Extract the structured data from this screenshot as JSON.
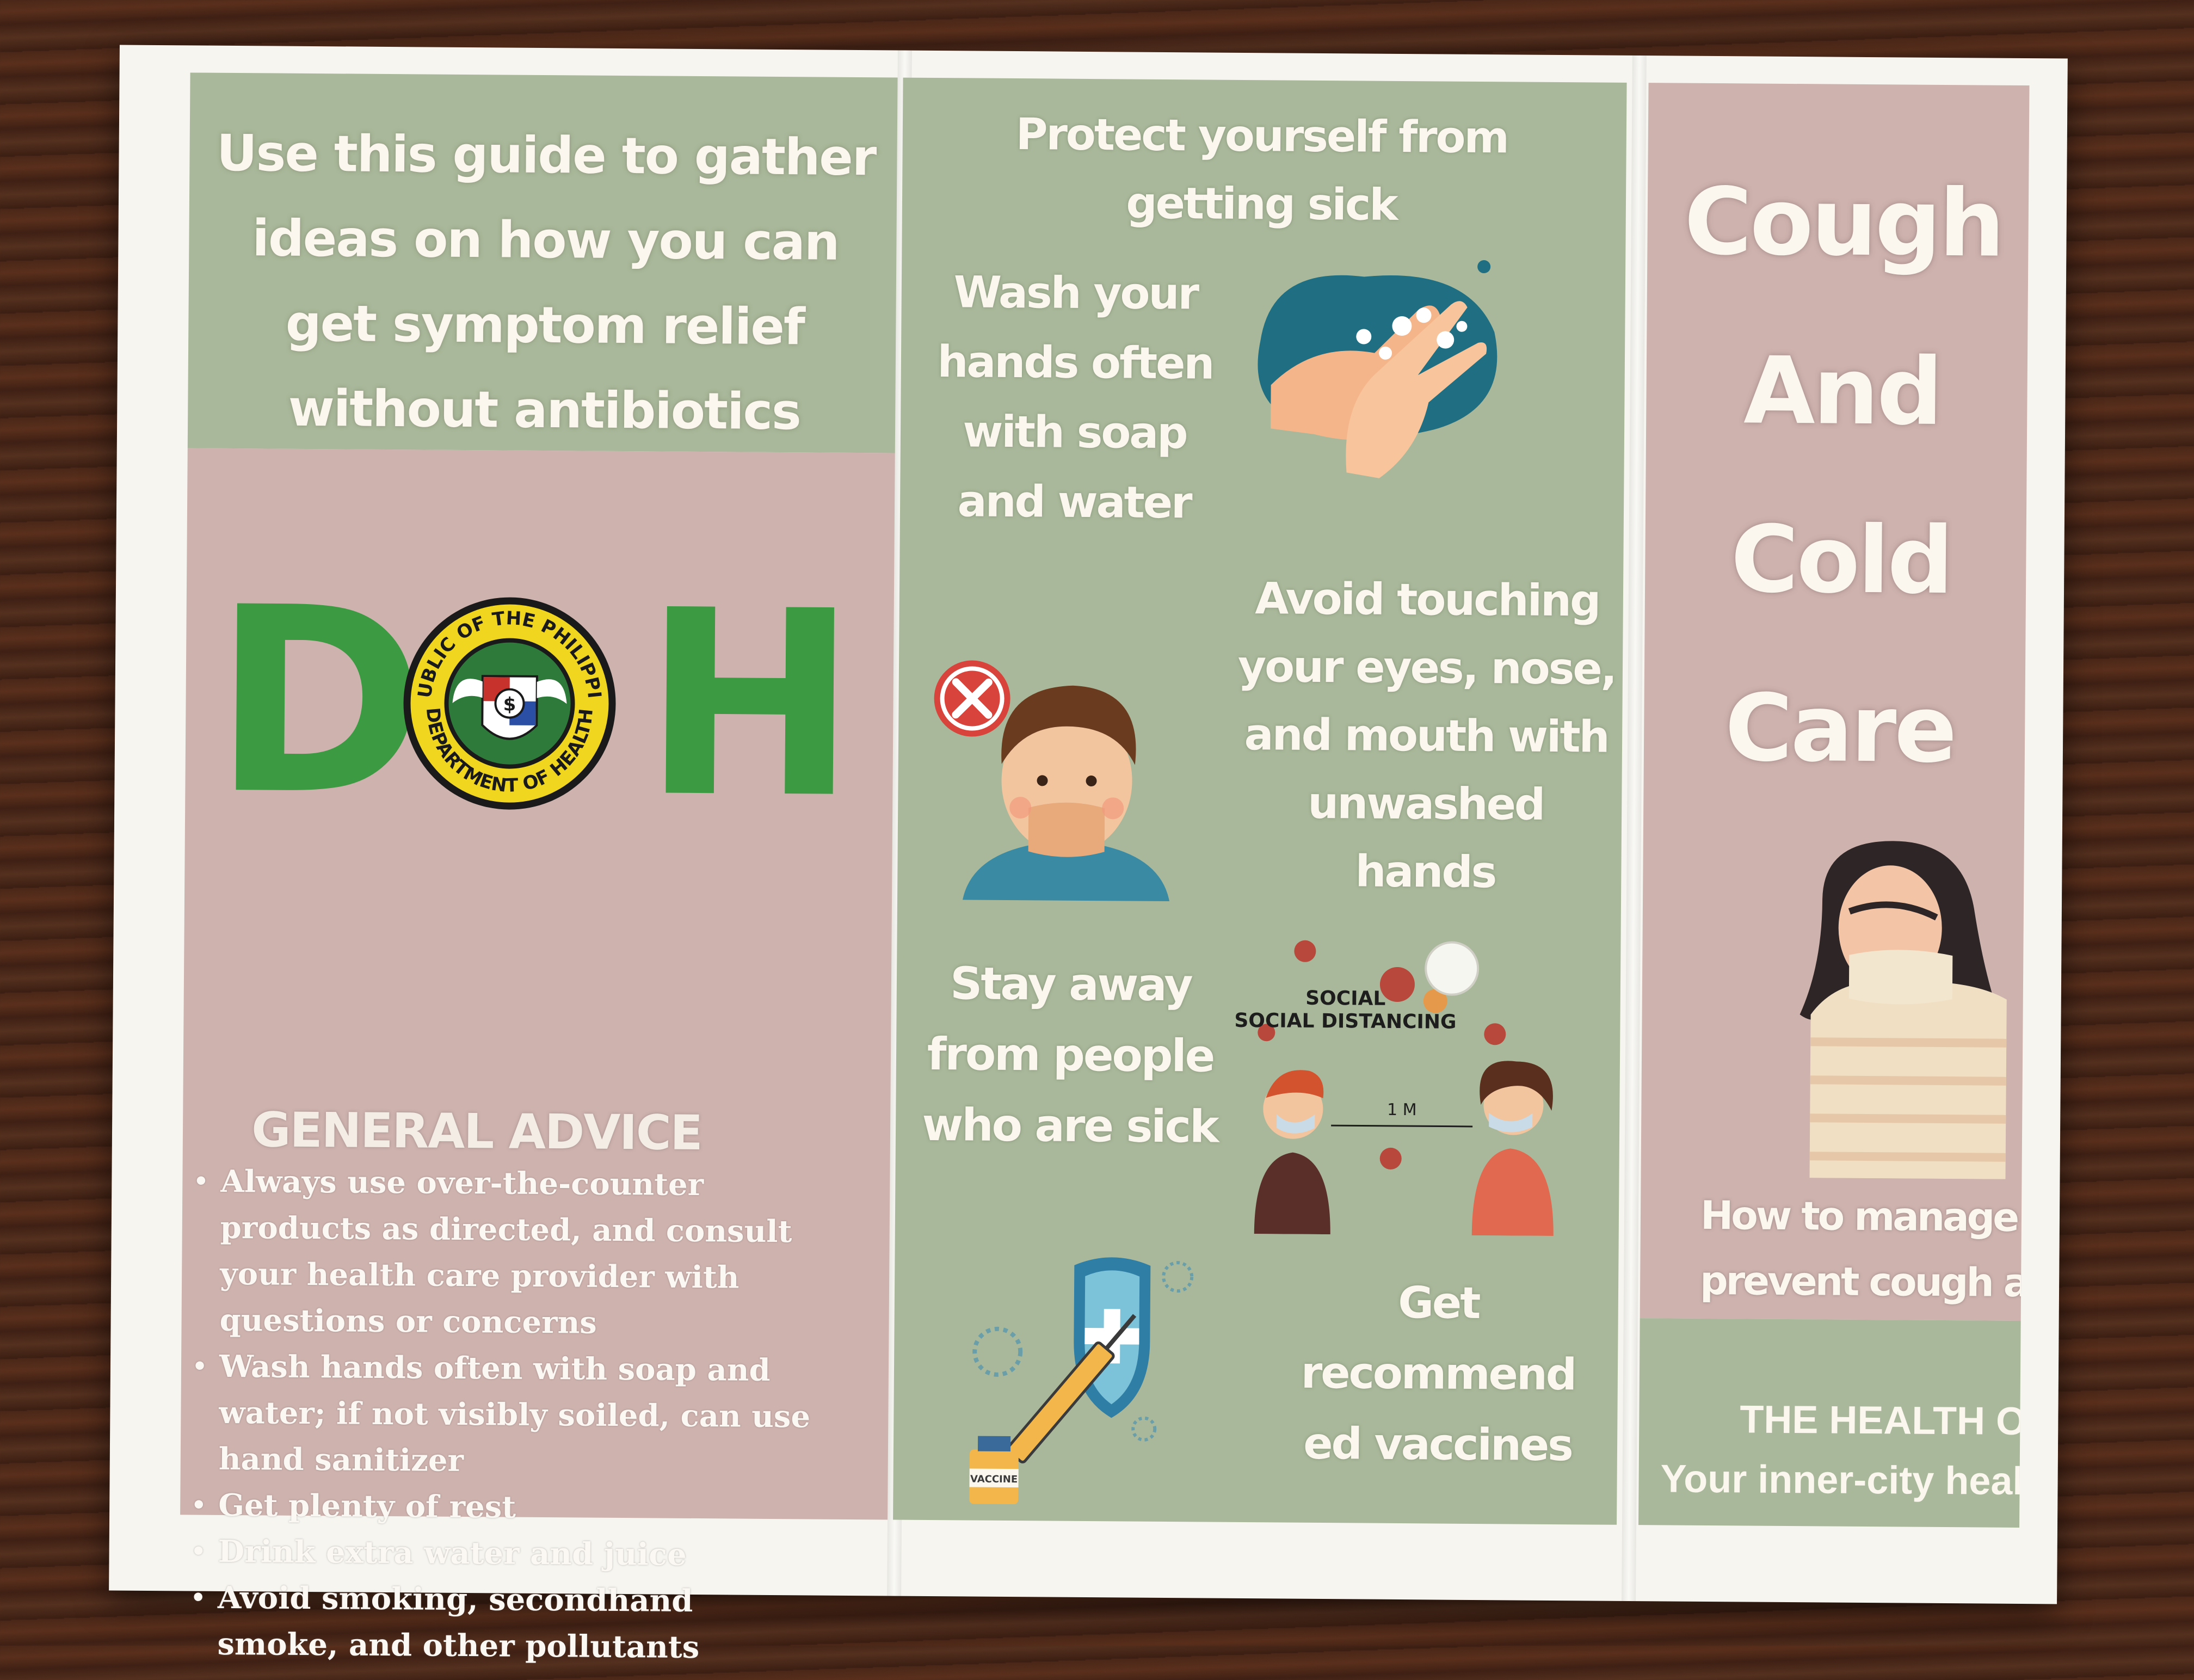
{
  "brochure": {
    "left_panel": {
      "intro": "Use this guide to gather ideas on how you can get symptom relief without antibiotics",
      "logo_letters": [
        "D",
        "H"
      ],
      "seal_text": [
        "REPUBLIC OF THE PHILIPPINES",
        "DEPARTMENT OF HEALTH"
      ],
      "general_advice_title": "GENERAL ADVICE",
      "advice_items": [
        "Always use over-the-counter products as directed, and consult your health care provider with questions or concerns",
        "Wash hands often with soap and water; if not visibly soiled, can use hand sanitizer",
        "Get plenty of rest",
        "Drink extra water and juice",
        "Avoid smoking, secondhand smoke, and other pollutants"
      ]
    },
    "middle_panel": {
      "title": "Protect yourself from getting sick",
      "tips": [
        "Wash your hands often with soap and water",
        "Avoid touching your eyes, nose, and mouth with unwashed hands",
        "Stay away from people who are sick",
        "Get recommend ed vaccines"
      ],
      "social_distancing_label": "SOCIAL DISTANCING",
      "distance_label": "1 M",
      "vaccine_label": "VACCINE"
    },
    "right_panel": {
      "title_lines": [
        "Cough",
        "And",
        "Cold",
        "Care"
      ],
      "subtitle_lines": [
        "How to manage and",
        "prevent cough and co"
      ],
      "office_name": "THE HEALTH OFFICE",
      "office_tagline": "Your inner-city health c"
    }
  },
  "colors": {
    "sage_green": "#a9b89a",
    "dusty_pink": "#ceb2ae",
    "doh_green": "#3c9a42",
    "wood": "#4a2718"
  }
}
